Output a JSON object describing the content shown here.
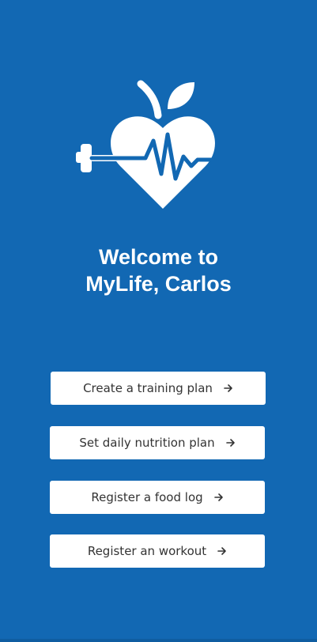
{
  "welcome": {
    "line1": "Welcome to",
    "line2": "MyLife, Carlos"
  },
  "logo": {
    "icon": "heart-apple-dumbbell-heartbeat-logo"
  },
  "buttons": [
    {
      "label": "Create a training plan",
      "icon": "arrow-right-icon"
    },
    {
      "label": "Set daily nutrition plan",
      "icon": "arrow-right-icon"
    },
    {
      "label": "Register a food log",
      "icon": "arrow-right-icon"
    },
    {
      "label": "Register an workout",
      "icon": "arrow-right-icon"
    }
  ],
  "colors": {
    "background": "#1268b3",
    "button_bg": "#ffffff",
    "button_text": "#333333",
    "heading_text": "#ffffff"
  }
}
